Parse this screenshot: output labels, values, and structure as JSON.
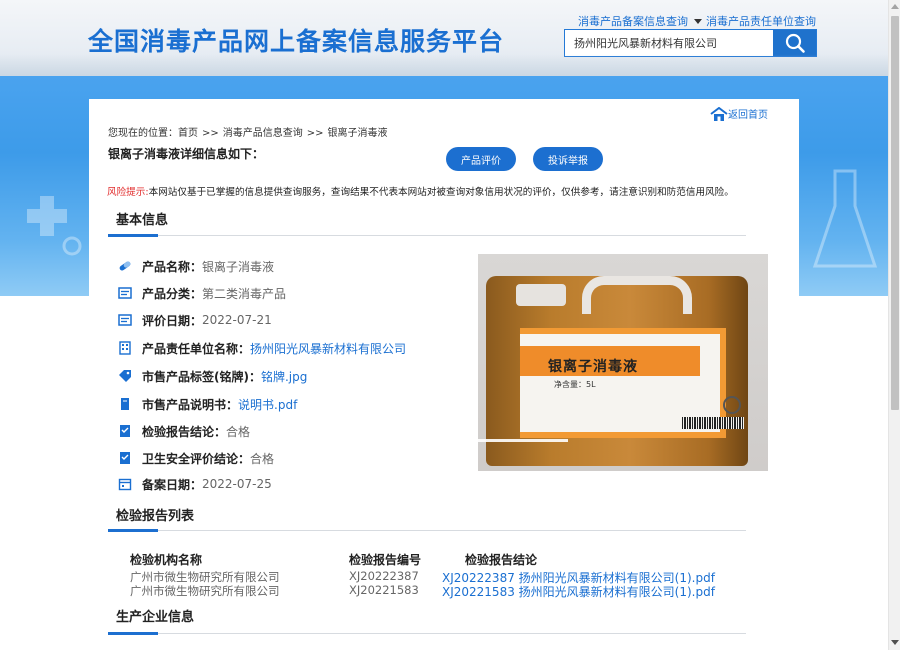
{
  "header": {
    "site_title": "全国消毒产品网上备案信息服务平台",
    "link_product_query": "消毒产品备案信息查询",
    "link_company_query": "消毒产品责任单位查询",
    "search_value": "扬州阳光风暴新材料有限公司",
    "search_icon": "search-icon"
  },
  "nav": {
    "back_home": "返回首页",
    "home_icon": "home-icon",
    "breadcrumb_prefix": "您现在的位置：",
    "breadcrumb_sep": ">>",
    "breadcrumb": [
      "首页",
      "消毒产品信息查询",
      "银离子消毒液"
    ]
  },
  "detail": {
    "title": "银离子消毒液详细信息如下：",
    "btn_evaluate": "产品评价",
    "btn_complaint": "投诉举报",
    "warning_label": "风险提示:",
    "warning_text": "本网站仅基于已掌握的信息提供查询服务，查询结果不代表本网站对被查询对象信用状况的评价，仅供参考，请注意识别和防范信用风险。"
  },
  "basic_info": {
    "section_title": "基本信息",
    "rows": [
      {
        "icon": "capsule-icon",
        "key": "产品名称：",
        "value": "银离子消毒液",
        "is_link": false
      },
      {
        "icon": "card-icon",
        "key": "产品分类：",
        "value": "第二类消毒产品",
        "is_link": false
      },
      {
        "icon": "card-icon",
        "key": "评价日期：",
        "value": "2022-07-21",
        "is_link": false
      },
      {
        "icon": "building-icon",
        "key": "产品责任单位名称：",
        "value": "扬州阳光风暴新材料有限公司",
        "is_link": true
      },
      {
        "icon": "tag-icon",
        "key": "市售产品标签(铭牌)：",
        "value": "铭牌.jpg",
        "is_link": true
      },
      {
        "icon": "book-icon",
        "key": "市售产品说明书：",
        "value": "说明书.pdf",
        "is_link": true
      },
      {
        "icon": "report-icon",
        "key": "检验报告结论：",
        "value": "合格",
        "is_link": false
      },
      {
        "icon": "report-icon",
        "key": "卫生安全评价结论：",
        "value": "合格",
        "is_link": false
      },
      {
        "icon": "calendar-icon",
        "key": "备案日期：",
        "value": "2022-07-25",
        "is_link": false
      }
    ],
    "image_label": "银离子消毒液",
    "image_sub": "净含量：5L"
  },
  "report_list": {
    "section_title": "检验报告列表",
    "headers": [
      "检验机构名称",
      "检验报告编号",
      "检验报告结论"
    ],
    "rows": [
      {
        "org": "广州市微生物研究所有限公司",
        "code": "XJ20222387",
        "file": "XJ20222387 扬州阳光风暴新材料有限公司(1).pdf"
      },
      {
        "org": "广州市微生物研究所有限公司",
        "code": "XJ20221583",
        "file": "XJ20221583 扬州阳光风暴新材料有限公司(1).pdf"
      }
    ]
  },
  "manufacturer": {
    "section_title": "生产企业信息"
  },
  "colors": {
    "brand_blue": "#1a6fd1",
    "button_blue": "#1c6fd0",
    "warning_red": "#e12b2b"
  }
}
